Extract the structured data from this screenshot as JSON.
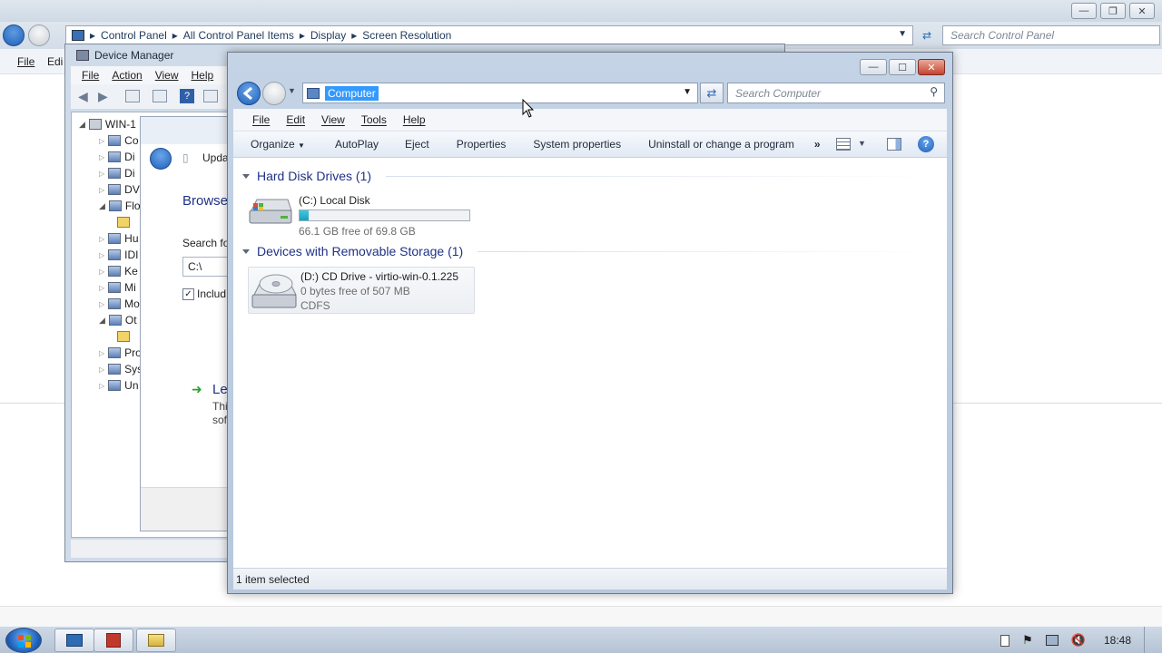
{
  "control_panel": {
    "breadcrumb": [
      "Control Panel",
      "All Control Panel Items",
      "Display",
      "Screen Resolution"
    ],
    "search_placeholder": "Search Control Panel",
    "menu": [
      "File",
      "Edi"
    ]
  },
  "device_manager": {
    "title": "Device Manager",
    "menu": [
      "File",
      "Action",
      "View",
      "Help"
    ],
    "tree_root": "WIN-1",
    "tree_items": [
      "Co",
      "Di",
      "Di",
      "DV",
      "Flo",
      "",
      "Hu",
      "IDI",
      "Ke",
      "Mi",
      "Mo",
      "Ot",
      "",
      "Pro",
      "Sys",
      "Un"
    ]
  },
  "update_driver": {
    "title": "Upda",
    "heading": "Browse",
    "search_label": "Search fo",
    "path_value": "C:\\",
    "include_label": "Includ",
    "let_me_pick": "Le",
    "desc_line1": "Thi",
    "desc_line2": "sof"
  },
  "explorer": {
    "address": "Computer",
    "search_placeholder": "Search Computer",
    "menu": [
      "File",
      "Edit",
      "View",
      "Tools",
      "Help"
    ],
    "commands": {
      "organize": "Organize",
      "autoplay": "AutoPlay",
      "eject": "Eject",
      "properties": "Properties",
      "system_properties": "System properties",
      "uninstall": "Uninstall or change a program",
      "more": "»"
    },
    "groups": {
      "hdd": {
        "header": "Hard Disk Drives (1)",
        "drive_name": "(C:) Local Disk",
        "free_text": "66.1 GB free of 69.8 GB",
        "used_fraction": 0.053
      },
      "removable": {
        "header": "Devices with Removable Storage (1)",
        "drive_name": "(D:) CD Drive - virtio-win-0.1.225",
        "free_text": "0 bytes free of 507 MB",
        "fs": "CDFS"
      }
    },
    "status": "1 item selected"
  },
  "taskbar": {
    "clock": "18:48"
  },
  "colors": {
    "accent_blue": "#1e3287",
    "selection": "#3399ff",
    "capacity_fill": "#26b0d0"
  }
}
